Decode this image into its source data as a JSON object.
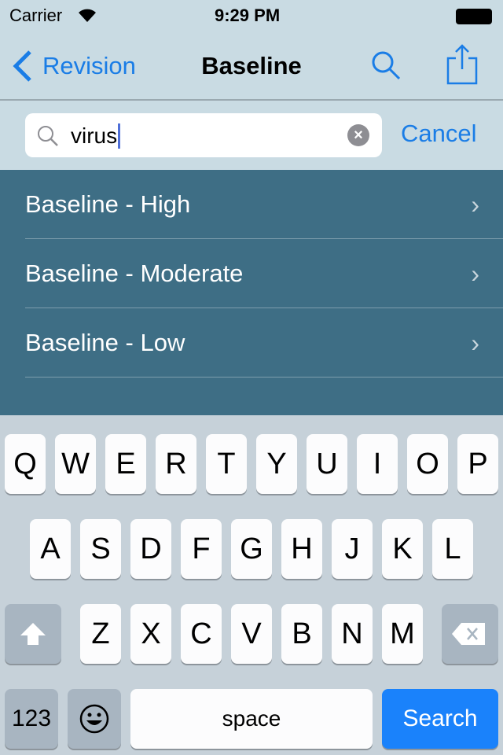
{
  "status": {
    "carrier": "Carrier",
    "time": "9:29 PM"
  },
  "nav": {
    "back": "Revision",
    "title": "Baseline"
  },
  "search": {
    "value": "virus",
    "cancel": "Cancel"
  },
  "results": [
    {
      "label": "Baseline - High"
    },
    {
      "label": "Baseline - Moderate"
    },
    {
      "label": "Baseline - Low"
    }
  ],
  "keyboard": {
    "row1": [
      "Q",
      "W",
      "E",
      "R",
      "T",
      "Y",
      "U",
      "I",
      "O",
      "P"
    ],
    "row2": [
      "A",
      "S",
      "D",
      "F",
      "G",
      "H",
      "J",
      "K",
      "L"
    ],
    "row3": [
      "Z",
      "X",
      "C",
      "V",
      "B",
      "N",
      "M"
    ],
    "numbers": "123",
    "space": "space",
    "search": "Search"
  },
  "colors": {
    "accent": "#1a7de6",
    "results_bg": "#3e6e85",
    "search_key": "#1a82fb"
  }
}
